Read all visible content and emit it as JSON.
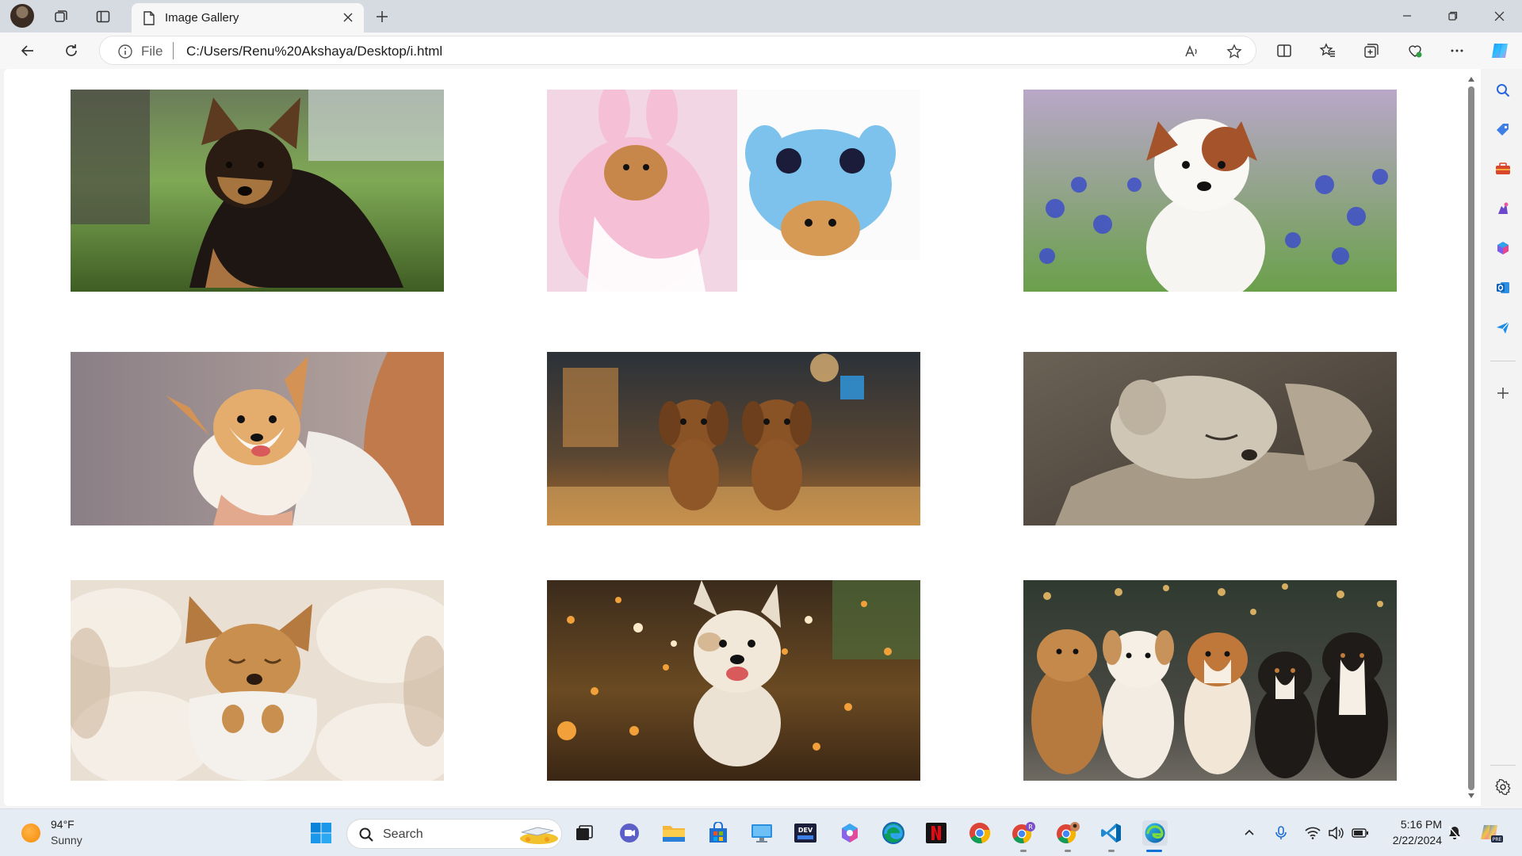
{
  "browser": {
    "tab": {
      "title": "Image Gallery"
    },
    "address": {
      "scheme_label": "File",
      "url": "C:/Users/Renu%20Akshaya/Desktop/i.html"
    }
  },
  "gallery": {
    "images": [
      {
        "subject": "German shepherd puppy lying on grass"
      },
      {
        "subject": "Pomeranian puppies in pink bunny and blue Stitch costumes"
      },
      {
        "subject": "Jack Russell puppy among bluebells"
      },
      {
        "subject": "Corgi puppy held by a woman"
      },
      {
        "subject": "Two golden puppies walking in the rain"
      },
      {
        "subject": "Sleeping white puppy in cupped hands"
      },
      {
        "subject": "Puppy sleeping wrapped in a blanket on fur"
      },
      {
        "subject": "Fluffy puppy running through autumn flowers"
      },
      {
        "subject": "Five puppies sitting in a row with bokeh lights"
      }
    ]
  },
  "taskbar": {
    "weather": {
      "temp": "94°F",
      "condition": "Sunny"
    },
    "search": {
      "placeholder": "Search"
    },
    "clock": {
      "time": "5:16 PM",
      "date": "2/22/2024"
    }
  }
}
